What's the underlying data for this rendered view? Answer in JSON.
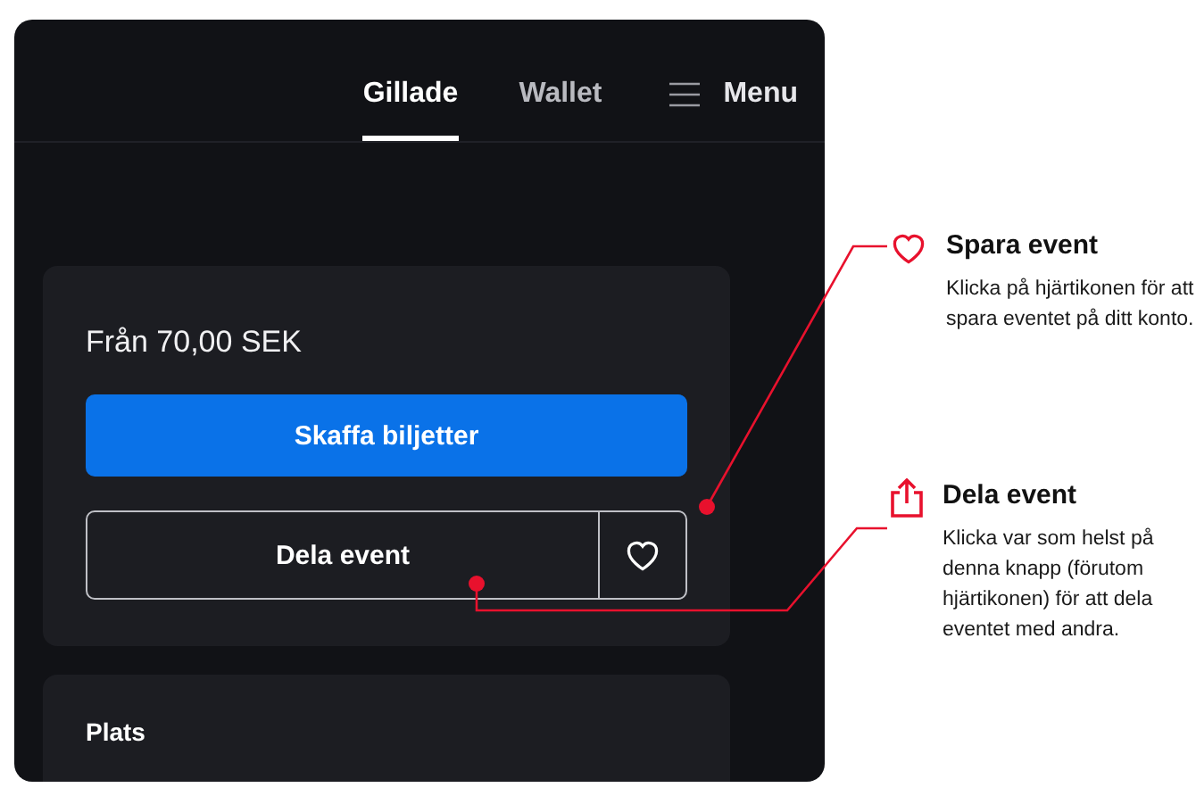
{
  "nav": {
    "tabs": [
      {
        "label": "Gillade",
        "selected": true
      },
      {
        "label": "Wallet",
        "selected": false
      }
    ],
    "menu": {
      "label": "Menu"
    }
  },
  "ticket_card": {
    "price": "Från 70,00 SEK",
    "buy_button": "Skaffa biljetter",
    "share_button": "Dela event"
  },
  "venue_card": {
    "title": "Plats"
  },
  "callouts": [
    {
      "kind": "heart",
      "title": "Spara event",
      "text": "Klicka på hjärtikonen för att spara eventet på ditt konto."
    },
    {
      "kind": "share",
      "title": "Dela event",
      "text": "Klicka var som helst på denna knapp (förutom hjärtikonen) för att dela eventet med andra."
    }
  ]
}
